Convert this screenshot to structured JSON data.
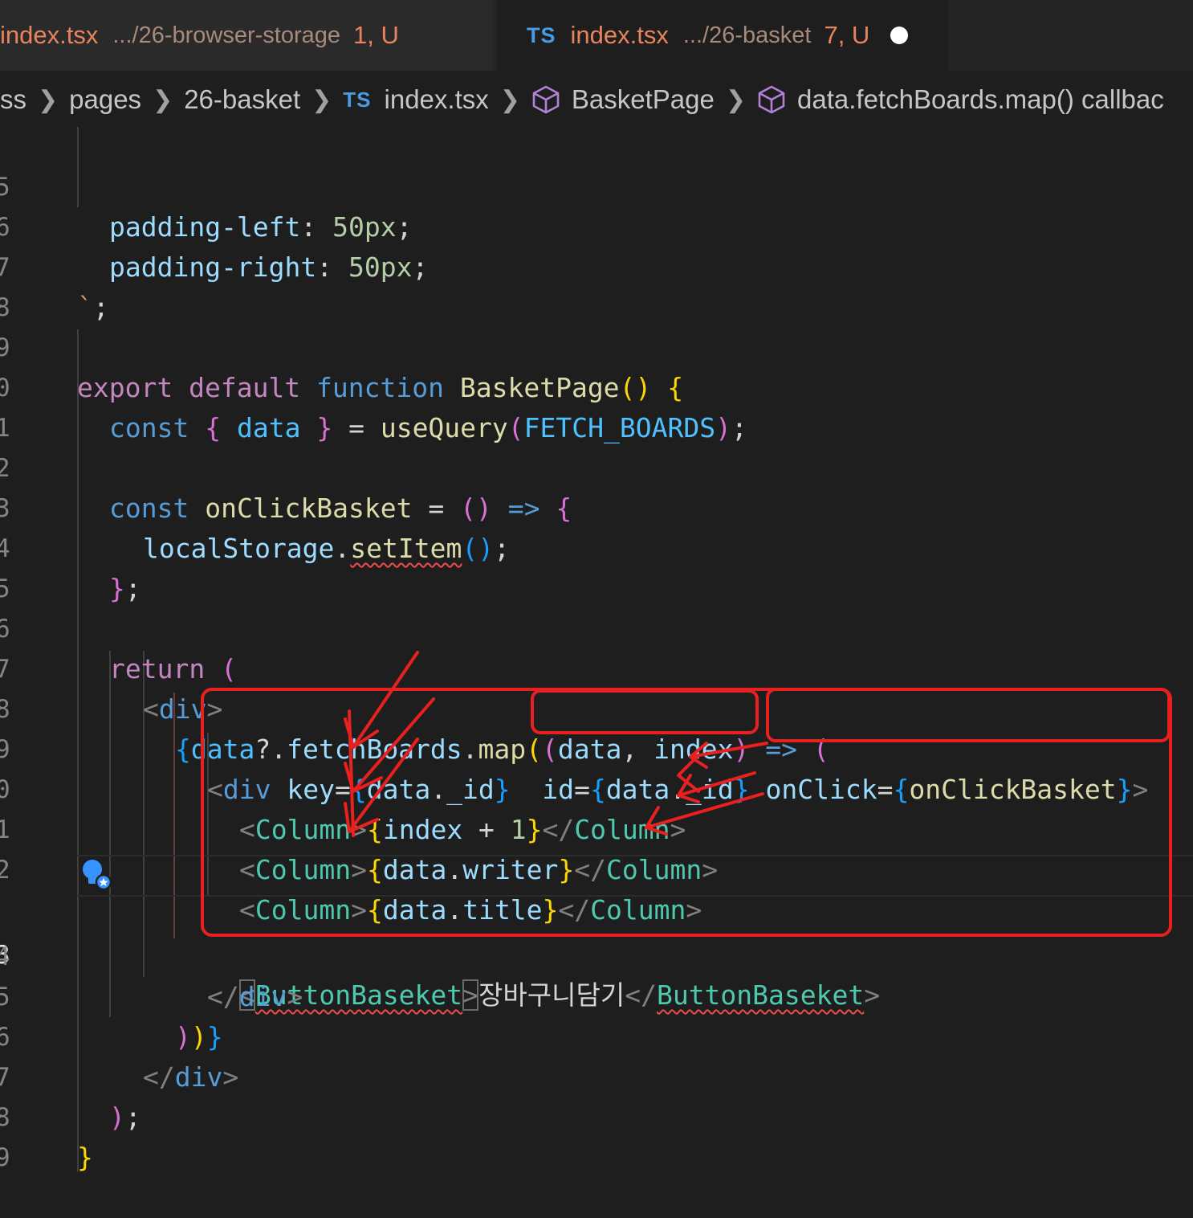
{
  "tabs": [
    {
      "lang": "",
      "name": "index.tsx",
      "path": ".../26-browser-storage",
      "status": "1, U",
      "active": false
    },
    {
      "lang": "TS",
      "name": "index.tsx",
      "path": ".../26-basket",
      "status": "7, U",
      "active": true,
      "unsaved": true
    }
  ],
  "breadcrumb": {
    "items": [
      "ss",
      "pages",
      "26-basket",
      "index.tsx",
      "BasketPage",
      "data.fetchBoards.map() callbac"
    ],
    "file_lang": "TS"
  },
  "line_numbers": [
    "5",
    "6",
    "7",
    "8",
    "9",
    "0",
    "1",
    "2",
    "3",
    "4",
    "5",
    "6",
    "7",
    "8",
    "9",
    "0",
    "1",
    "2",
    "3",
    "4",
    "5",
    "6",
    "7",
    "8",
    "9"
  ],
  "code": {
    "l5": [
      "padding-left",
      ": ",
      "50px",
      ";"
    ],
    "l6": [
      "padding-right",
      ": ",
      "50px",
      ";"
    ],
    "l7": [
      "`",
      ";"
    ],
    "l9": [
      "export",
      "default",
      "function",
      "BasketPage",
      "()",
      "{"
    ],
    "l10": [
      "const",
      "{",
      "data",
      "}",
      "=",
      "useQuery",
      "(",
      "FETCH_BOARDS",
      ")",
      ";"
    ],
    "l12": [
      "const",
      "onClickBasket",
      "=",
      "()",
      "=>",
      "{"
    ],
    "l13": [
      "localStorage",
      ".",
      "setItem",
      "()",
      ";"
    ],
    "l14": [
      "}",
      ";"
    ],
    "l16": [
      "return",
      "("
    ],
    "l17": [
      "<",
      "div",
      ">"
    ],
    "l18": [
      "{",
      "data",
      "?.",
      "fetchBoards",
      ".",
      "map",
      "(",
      "(",
      "data",
      ", ",
      "index",
      ")",
      "=>",
      "("
    ],
    "l19": [
      "<",
      "div",
      "key",
      "=",
      "{",
      "data",
      ".",
      "_id",
      "}",
      "id",
      "=",
      "{",
      "data",
      ".",
      "_id",
      "}",
      "onClick",
      "=",
      "{",
      "onClickBasket",
      "}",
      ">"
    ],
    "l20": [
      "<",
      "Column",
      ">",
      "{",
      "index",
      " + ",
      "1",
      "}",
      "</",
      "Column",
      ">"
    ],
    "l21": [
      "<",
      "Column",
      ">",
      "{",
      "data",
      ".",
      "writer",
      "}",
      "</",
      "Column",
      ">"
    ],
    "l22": [
      "<",
      "Column",
      ">",
      "{",
      "data",
      ".",
      "title",
      "}",
      "</",
      "Column",
      ">"
    ],
    "l23": [
      "<",
      "ButtonBaseket",
      ">",
      "장바구니담기",
      "</",
      "ButtonBaseket",
      ">"
    ],
    "l24": [
      "</",
      "div",
      ">"
    ],
    "l25": [
      ")",
      ")",
      "}"
    ],
    "l26": [
      "</",
      "div",
      ">"
    ],
    "l27": [
      ")",
      ";"
    ],
    "l28": [
      "}"
    ]
  },
  "annotation_color": "#e8201f",
  "icons": [
    "typescript-icon",
    "symbol-method-icon",
    "chevron-right-icon",
    "lightbulb-sparkle-icon",
    "dirty-dot-icon"
  ]
}
